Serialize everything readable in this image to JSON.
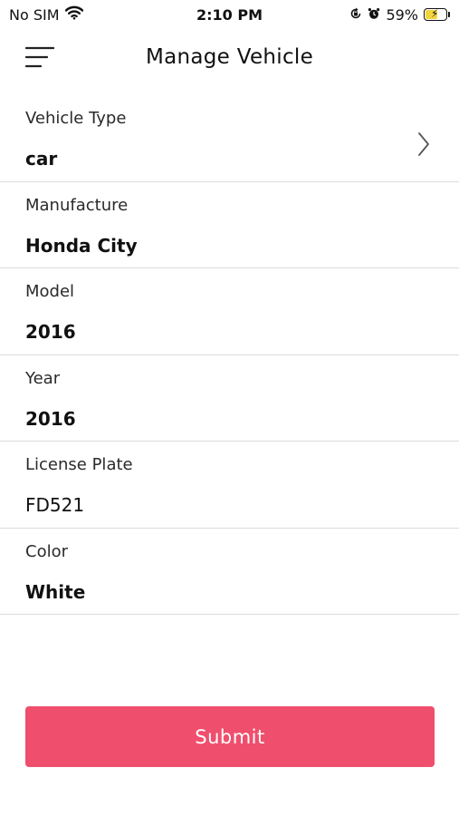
{
  "status_bar": {
    "carrier": "No SIM",
    "time": "2:10 PM",
    "battery_percent": "59%",
    "battery_level": 0.59,
    "icons": [
      "wifi-icon",
      "orientation-lock-icon",
      "alarm-icon",
      "battery-charging-icon"
    ]
  },
  "header": {
    "title": "Manage Vehicle",
    "menu_icon": "hamburger-menu-icon"
  },
  "fields": [
    {
      "label": "Vehicle Type",
      "value": "car",
      "has_chevron": true
    },
    {
      "label": "Manufacture",
      "value": "Honda City"
    },
    {
      "label": "Model",
      "value": "2016"
    },
    {
      "label": "Year",
      "value": "2016"
    },
    {
      "label": "License Plate",
      "value": "FD521"
    },
    {
      "label": "Color",
      "value": "White"
    }
  ],
  "submit": {
    "label": "Submit"
  },
  "colors": {
    "accent": "#f04e6d",
    "divider": "#dcdcdc",
    "battery_fill": "#f2d53c"
  }
}
